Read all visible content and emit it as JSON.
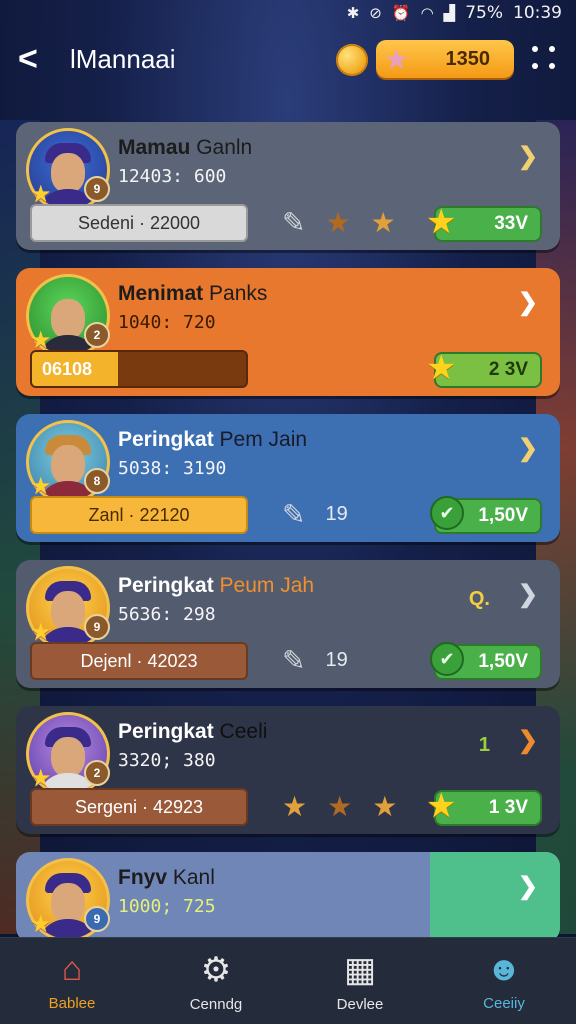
{
  "status_bar": {
    "battery": "75%",
    "time": "10:39",
    "icons": [
      "bluetooth-icon",
      "mute-icon",
      "alarm-icon",
      "wifi-icon",
      "signal-icon"
    ]
  },
  "header": {
    "title": "lMannaai",
    "balance": "1350"
  },
  "cards": [
    {
      "name": "Mamau",
      "name_accent": "Ganln",
      "sub": "12403: 600",
      "bar_label": "Sedeni · 22000",
      "mid": [
        "wrench",
        "star",
        "star"
      ],
      "reward": "33V",
      "badge": "9"
    },
    {
      "name": "Menimat",
      "name_accent": "Panks",
      "sub": "1040: 720",
      "bar_label": "06108",
      "reward": "2 3V",
      "badge": "2"
    },
    {
      "name": "Peringkat",
      "name_accent": "Pem Jain",
      "sub": "5038: 3190",
      "bar_label": "Zanl · 22120",
      "mid_num": "19",
      "reward": "1,50V",
      "badge": "8"
    },
    {
      "name": "Peringkat",
      "name_accent": "Peum Jah",
      "sub": "5636: 298",
      "bar_label": "Dejenl · 42023",
      "mid_num": "19",
      "reward": "1,50V",
      "side_mark": "Q.",
      "badge": "9"
    },
    {
      "name": "Peringkat",
      "name_accent": "Ceeli",
      "sub": "3320; 380",
      "bar_label": "Sergeni · 42923",
      "reward": "1 3V",
      "side_mark": "1",
      "badge": "2"
    },
    {
      "name": "Fnyv",
      "name_accent": "Kanl",
      "sub": "1000; 725",
      "badge": "9"
    }
  ],
  "nav": [
    {
      "label": "Bablee",
      "icon": "home-icon"
    },
    {
      "label": "Cenndg",
      "icon": "gear-icon"
    },
    {
      "label": "Devlee",
      "icon": "device-icon"
    },
    {
      "label": "Ceeiiy",
      "icon": "profile-icon"
    }
  ]
}
